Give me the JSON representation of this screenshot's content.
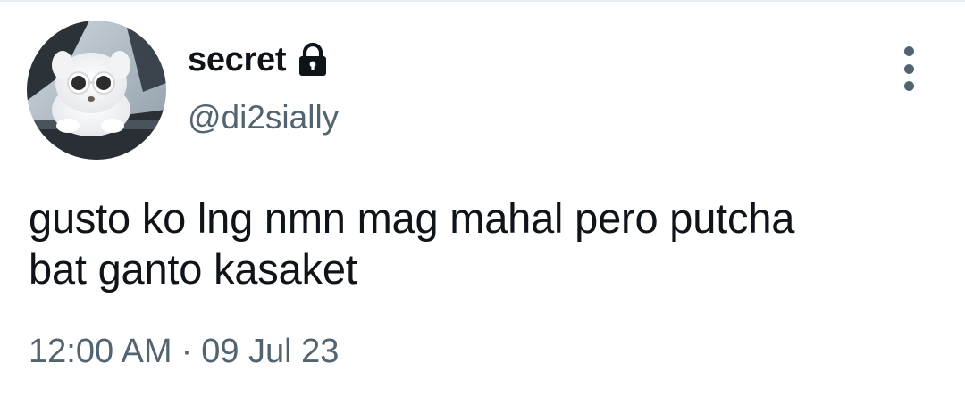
{
  "user": {
    "display_name": "secret",
    "handle": "@di2sially",
    "avatar_icon": "avatar-white-fluffy-dog-in-sunglasses",
    "protected_icon": "lock-icon"
  },
  "tweet": {
    "text_lines": [
      "gusto ko lng nmn mag mahal pero putcha",
      "bat ganto kasaket"
    ],
    "time": "12:00 AM",
    "separator": "·",
    "date": "09 Jul 23"
  },
  "actions": {
    "more_icon": "more-vertical-icon"
  },
  "colors": {
    "text_primary": "#0f1419",
    "text_secondary": "#536471",
    "divider": "#e6ecf0"
  }
}
